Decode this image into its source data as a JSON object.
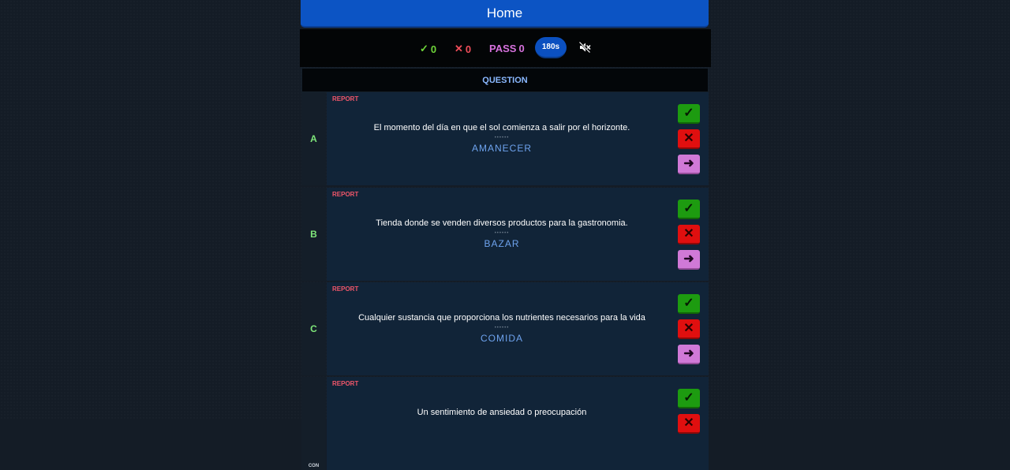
{
  "header": {
    "home_label": "Home"
  },
  "stats": {
    "correct_icon": "✓",
    "correct_count": "0",
    "wrong_icon": "✕",
    "wrong_count": "0",
    "pass_label": "PASS",
    "pass_count": "0",
    "timer": "180s",
    "sound_icon": "speaker-muted-icon"
  },
  "table": {
    "header": "QUESTION"
  },
  "rows": [
    {
      "letter": "A",
      "report": "REPORT",
      "clue": "El momento del día en que el sol comienza a salir por el horizonte.",
      "dots": "••••••",
      "answer": "AMANECER"
    },
    {
      "letter": "B",
      "report": "REPORT",
      "clue": "Tienda donde se venden diversos productos para la gastronomia.",
      "dots": "••••••",
      "answer": "BAZAR"
    },
    {
      "letter": "C",
      "report": "REPORT",
      "clue": "Cualquier sustancia que proporciona los nutrientes necesarios para la vida",
      "dots": "••••••",
      "answer": "COMIDA"
    },
    {
      "letter": "CON",
      "report": "REPORT",
      "clue": "Un sentimiento de ansiedad o preocupación",
      "dots": "",
      "answer": ""
    }
  ],
  "buttons": {
    "correct": "✓",
    "wrong": "✕",
    "pass": "➜"
  },
  "colors": {
    "home": "#0c54c4",
    "correct": "#1d9b10",
    "wrong": "#e00f0f",
    "pass": "#d079d7",
    "answer": "#6ea3ee"
  }
}
